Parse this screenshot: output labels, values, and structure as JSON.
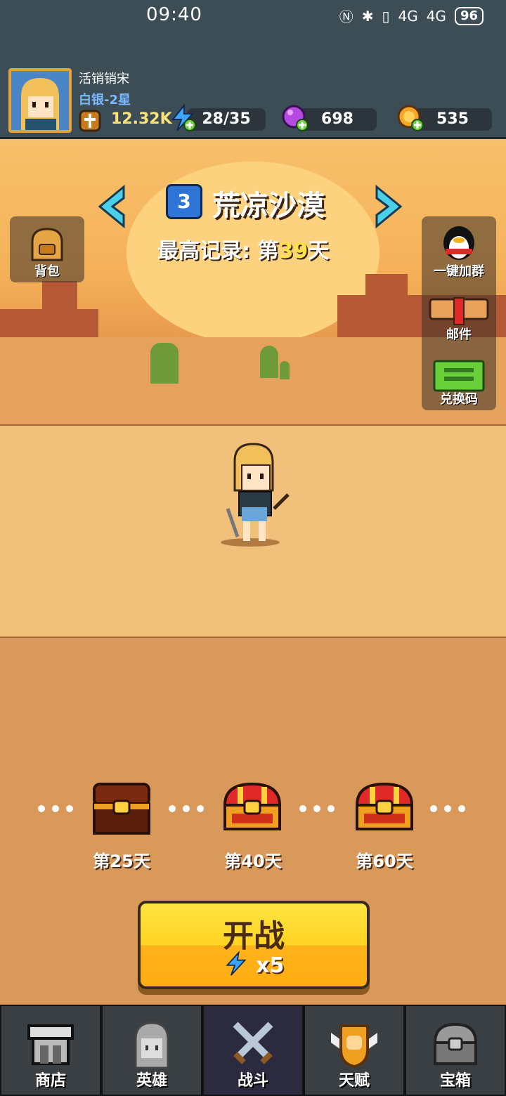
{
  "status_bar": {
    "time": "09:40",
    "battery": "96",
    "signal_a": "4G",
    "signal_b": "4G"
  },
  "player": {
    "name": "活销销宋",
    "rank": "白银-2星",
    "power": "12.32K"
  },
  "resources": {
    "energy": "28/35",
    "gems": "698",
    "coins": "535"
  },
  "level": {
    "number": "3",
    "name": "荒凉沙漠",
    "record_prefix": "最高记录: 第",
    "record_value": "39",
    "record_suffix": "天"
  },
  "side_buttons": {
    "backpack": "背包",
    "join_group": "一键加群",
    "mail": "邮件",
    "redeem": "兑换码"
  },
  "chests": [
    {
      "label": "第25天"
    },
    {
      "label": "第40天"
    },
    {
      "label": "第60天"
    }
  ],
  "fight": {
    "title": "开战",
    "cost": "x5"
  },
  "nav": [
    {
      "label": "商店",
      "icon": "shop-icon"
    },
    {
      "label": "英雄",
      "icon": "hero-icon"
    },
    {
      "label": "战斗",
      "icon": "crossed-swords-icon"
    },
    {
      "label": "天赋",
      "icon": "talent-fist-icon"
    },
    {
      "label": "宝箱",
      "icon": "chest-icon"
    }
  ]
}
